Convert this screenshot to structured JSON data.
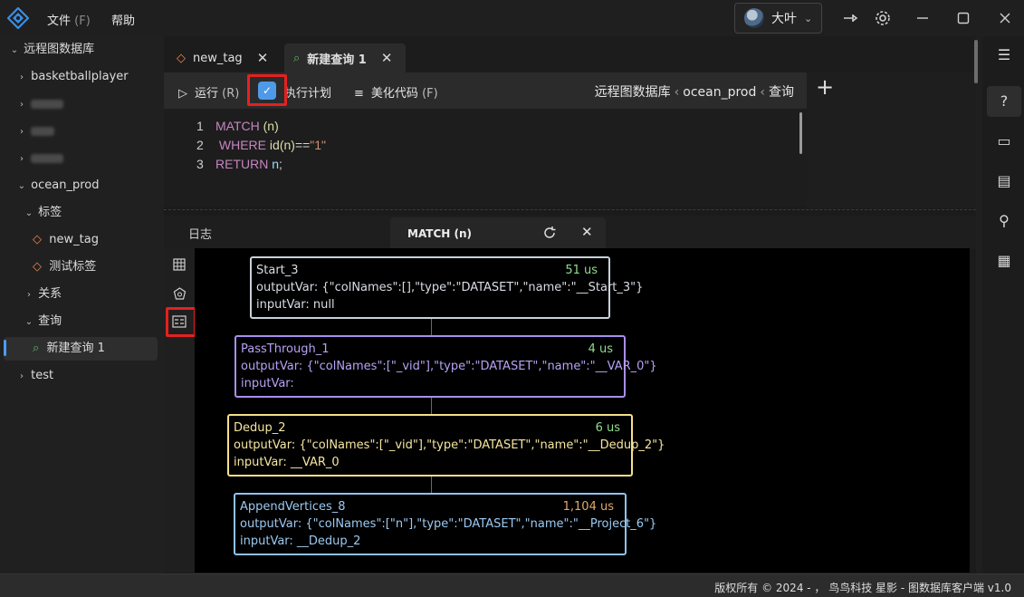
{
  "menu": {
    "file": "文件",
    "file_accel": "(F)",
    "help": "帮助"
  },
  "user": {
    "name": "大叶"
  },
  "sidebar": {
    "items": [
      {
        "label": "远程图数据库"
      },
      {
        "label": "basketballplayer"
      },
      {
        "label": "ocean_prod"
      },
      {
        "label": "标签"
      },
      {
        "label": "new_tag"
      },
      {
        "label": "测试标签"
      },
      {
        "label": "关系"
      },
      {
        "label": "查询"
      },
      {
        "label": "新建查询 1"
      },
      {
        "label": "test"
      }
    ]
  },
  "tabs": [
    {
      "label": "new_tag"
    },
    {
      "label": "新建查询 1"
    }
  ],
  "toolbar": {
    "run": "运行",
    "run_accel": "(R)",
    "explain": "执行计划",
    "beautify": "美化代码",
    "beautify_accel": "(F)",
    "breadcrumb": [
      "远程图数据库",
      "ocean_prod",
      "查询"
    ]
  },
  "editor": {
    "lines": [
      {
        "num": "1"
      },
      {
        "num": "2"
      },
      {
        "num": "3"
      }
    ],
    "line1": {
      "kw": "MATCH",
      "rest": "(n)"
    },
    "line2": {
      "kw": "WHERE",
      "fn": "id",
      "args": "(n)",
      "op": "==",
      "str": "\"1\""
    },
    "line3": {
      "kw": "RETURN",
      "var": "n",
      "semi": ";"
    }
  },
  "results": {
    "log_label": "日志",
    "plan_tab": "MATCH (n)"
  },
  "plan": {
    "nodes": [
      {
        "name": "Start_3",
        "time": "51 us",
        "output": "outputVar: {\"colNames\":[],\"type\":\"DATASET\",\"name\":\"__Start_3\"}",
        "input": "inputVar: null",
        "color": "#c9d1d9"
      },
      {
        "name": "PassThrough_1",
        "time": "4 us",
        "output": "outputVar: {\"colNames\":[\"_vid\"],\"type\":\"DATASET\",\"name\":\"__VAR_0\"}",
        "input": "inputVar:",
        "color": "#a98ef0"
      },
      {
        "name": "Dedup_2",
        "time": "6 us",
        "output": "outputVar: {\"colNames\":[\"_vid\"],\"type\":\"DATASET\",\"name\":\"__Dedup_2\"}",
        "input": "inputVar: __VAR_0",
        "color": "#f5e08a"
      },
      {
        "name": "AppendVertices_8",
        "time": "1,104 us",
        "output": "outputVar: {\"colNames\":[\"n\"],\"type\":\"DATASET\",\"name\":\"__Project_6\"}",
        "input": "inputVar: __Dedup_2",
        "color": "#8fc3f0"
      }
    ]
  },
  "status": {
    "text": "版权所有 © 2024 - ， 鸟鸟科技  星影 - 图数据库客户端  v1.0"
  },
  "icons": [
    "search-icon",
    "tag-icon",
    "play-icon",
    "check-icon",
    "list-icon",
    "plus-icon",
    "refresh-icon",
    "close-icon",
    "table-icon",
    "graph-icon",
    "plan-icon",
    "help-icon",
    "card-icon",
    "document-icon",
    "wand-icon",
    "calculator-icon",
    "pin-icon",
    "gear-icon",
    "minimize-icon",
    "maximize-icon",
    "menu-icon"
  ]
}
